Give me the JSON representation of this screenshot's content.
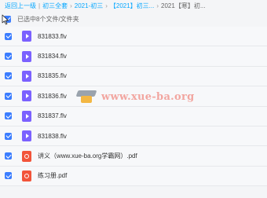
{
  "breadcrumb": {
    "items": [
      "返回上一级",
      "初三全套",
      "2021-初三",
      "【2021】初三...",
      "2021【寒】初..."
    ]
  },
  "selection": {
    "text": "已选中8个文件/文件夹"
  },
  "files": [
    {
      "name": "831833.flv",
      "type": "video",
      "checked": true
    },
    {
      "name": "831834.flv",
      "type": "video",
      "checked": true
    },
    {
      "name": "831835.flv",
      "type": "video",
      "checked": true
    },
    {
      "name": "831836.flv",
      "type": "video",
      "checked": true
    },
    {
      "name": "831837.flv",
      "type": "video",
      "checked": true
    },
    {
      "name": "831838.flv",
      "type": "video",
      "checked": true
    },
    {
      "name": "讲义（www.xue-ba.org学霸网）.pdf",
      "type": "pdf",
      "checked": true
    },
    {
      "name": "练习册.pdf",
      "type": "pdf",
      "checked": true
    }
  ],
  "watermark": {
    "text": "www.xue-ba.org"
  },
  "colors": {
    "accent": "#3b7dff",
    "link": "#06a7ff",
    "video_icon": "#7b61ff",
    "pdf_icon": "#f2543a"
  }
}
